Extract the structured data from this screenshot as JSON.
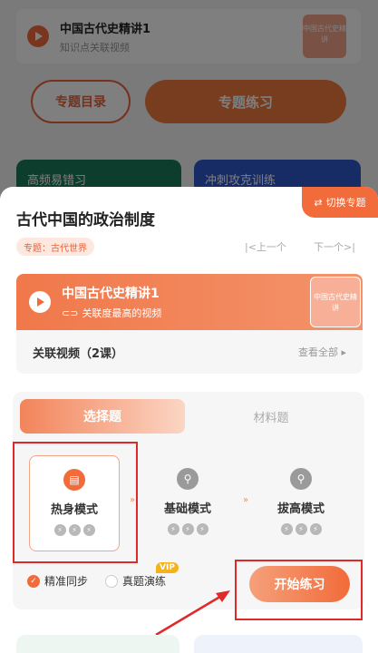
{
  "background": {
    "card_title": "中国古代史精讲1",
    "card_sub": "知识点关联视频",
    "thumb_text": "中国古代史精讲",
    "btn_catalog": "专题目录",
    "btn_practice": "专题练习",
    "tile1": "高频易错习",
    "tile2": "冲刺攻克训练"
  },
  "sheet": {
    "switch_label": "切换专题",
    "title": "古代中国的政治制度",
    "tag": "专题：古代世界",
    "prev": "|<上一个",
    "next": "下一个>|"
  },
  "video": {
    "title": "中国古代史精讲1",
    "sub": "关联度最高的视频",
    "thumb_text": "中国古代史精讲"
  },
  "related": {
    "label": "关联视频（2课）",
    "more": "查看全部 ▸"
  },
  "tabs": {
    "active": "选择题",
    "inactive": "材料题"
  },
  "modes": [
    {
      "name": "热身模式",
      "state": "active"
    },
    {
      "name": "基础模式",
      "state": "locked"
    },
    {
      "name": "拔高模式",
      "state": "locked"
    }
  ],
  "options": {
    "sync": "精准同步",
    "real": "真题演练",
    "vip": "VIP"
  },
  "start_button": "开始练习",
  "colors": {
    "accent": "#f26b3a",
    "highlight": "#e02a2a"
  }
}
